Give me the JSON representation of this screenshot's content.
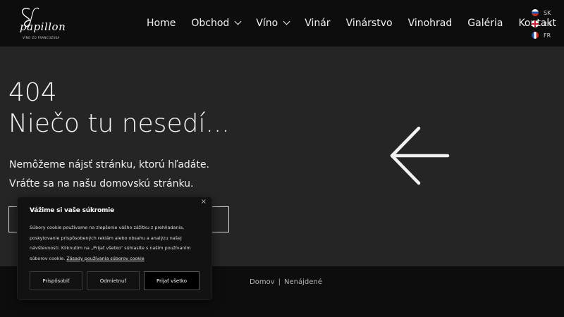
{
  "logo": {
    "script": "papillon",
    "subtitle": "VÍNO ZO FRANCÚZSKA"
  },
  "nav": {
    "items": [
      {
        "label": "Home",
        "dropdown": false
      },
      {
        "label": "Obchod",
        "dropdown": true
      },
      {
        "label": "Víno",
        "dropdown": true
      },
      {
        "label": "Vinár",
        "dropdown": false
      },
      {
        "label": "Vinárstvo",
        "dropdown": false
      },
      {
        "label": "Vinohrad",
        "dropdown": false
      },
      {
        "label": "Galéria",
        "dropdown": false
      },
      {
        "label": "Kontakt",
        "dropdown": false
      }
    ]
  },
  "languages": [
    {
      "code": "SK",
      "flag": "sk-flag-icon"
    },
    {
      "code": "EN",
      "flag": "en-flag-icon"
    },
    {
      "code": "FR",
      "flag": "fr-flag-icon"
    }
  ],
  "error": {
    "code": "404",
    "headline": "Niečo tu nesedí...",
    "message_line1": "Nemôžeme nájsť stránku, ktorú hľadáte.",
    "message_line2": "Vráťte sa na našu domovskú stránku.",
    "arrow_icon": "arrow-left-icon"
  },
  "breadcrumb": {
    "home": "Domov",
    "separator": "|",
    "current": "Nenájdené"
  },
  "cookie": {
    "close": "×",
    "title": "Vážime si vaše súkromie",
    "text": "Súbory cookie používame na zlepšenie vášho zážitku z prehliadania, poskytovanie prispôsobených reklám alebo obsahu a analýzu našej návštevnosti. Kliknutím na „Prijať všetko“ súhlasíte s naším používaním súborov cookie.",
    "link": "Zásady používania súborov cookie",
    "btn_customize": "Prispôsobiť",
    "btn_reject": "Odmietnuť",
    "btn_accept": "Prijať všetko"
  },
  "colors": {
    "header_bg": "#0d0d0d",
    "page_bg": "#252525",
    "text": "#f4f4f4"
  }
}
